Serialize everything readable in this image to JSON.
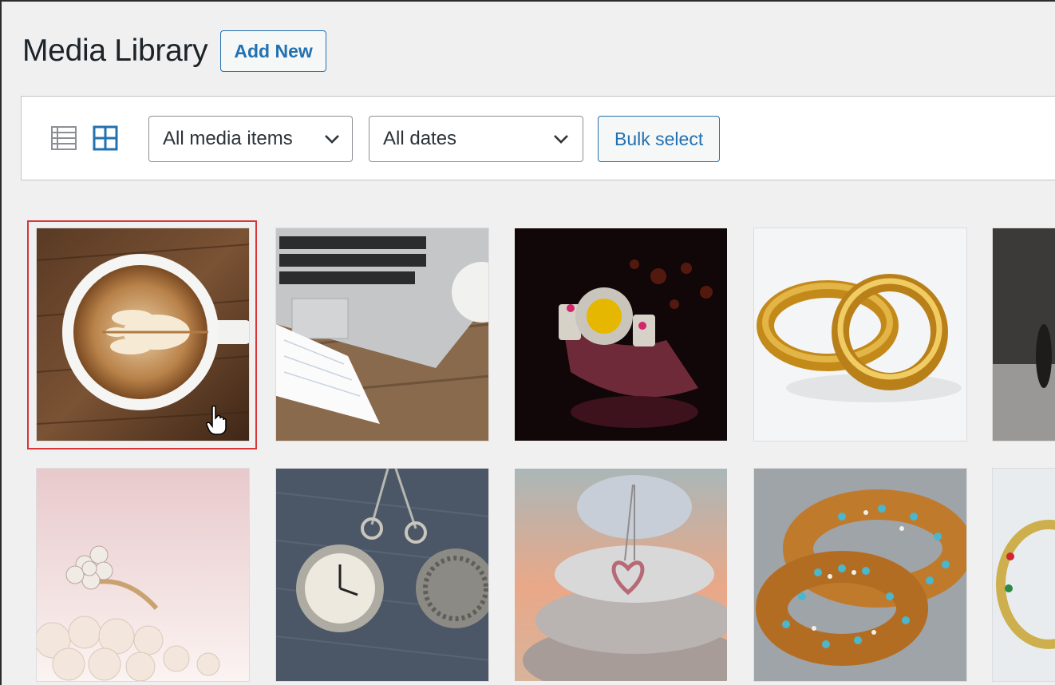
{
  "header": {
    "title": "Media Library",
    "add_new_label": "Add New"
  },
  "toolbar": {
    "view_modes": [
      {
        "name": "list-view",
        "icon": "list-icon",
        "active": false
      },
      {
        "name": "grid-view",
        "icon": "grid-icon",
        "active": true
      }
    ],
    "type_filter": {
      "selected": "All media items"
    },
    "date_filter": {
      "selected": "All dates"
    },
    "bulk_select_label": "Bulk select"
  },
  "grid": {
    "items": [
      {
        "subject": "latte art coffee cup",
        "selected": true
      },
      {
        "subject": "laptop and notebook on wooden desk",
        "selected": false
      },
      {
        "subject": "jeweled wristwatch on dark background",
        "selected": false
      },
      {
        "subject": "pair of gold wedding rings",
        "selected": false
      },
      {
        "subject": "dark object partially visible",
        "selected": false
      },
      {
        "subject": "flower diamond ring with pearls",
        "selected": false
      },
      {
        "subject": "pocket watch pendants on denim",
        "selected": false
      },
      {
        "subject": "heart pendant on stacked stones",
        "selected": false
      },
      {
        "subject": "turquoise and pearl gold bangles",
        "selected": false
      },
      {
        "subject": "jeweled bangle partially visible",
        "selected": false
      }
    ]
  },
  "colors": {
    "accent": "#2271b1",
    "selection_outline": "#d63638",
    "page_background": "#f0f0f1"
  }
}
